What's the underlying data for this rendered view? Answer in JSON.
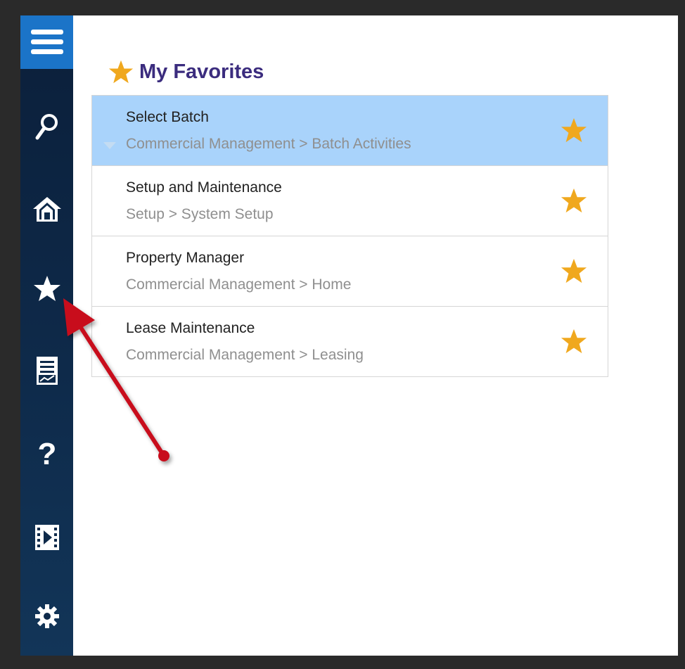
{
  "sidebar": {
    "items": [
      {
        "icon": "menu-icon"
      },
      {
        "icon": "search-icon"
      },
      {
        "icon": "home-icon"
      },
      {
        "icon": "star-icon"
      },
      {
        "icon": "report-icon"
      },
      {
        "icon": "help-icon"
      },
      {
        "icon": "video-icon"
      },
      {
        "icon": "gear-icon"
      }
    ]
  },
  "favorites": {
    "title": "My Favorites",
    "items": [
      {
        "title": "Select Batch",
        "path": "Commercial Management > Batch Activities"
      },
      {
        "title": "Setup and Maintenance",
        "path": "Setup > System Setup"
      },
      {
        "title": "Property Manager",
        "path": "Commercial Management > Home"
      },
      {
        "title": "Lease Maintenance",
        "path": "Commercial Management > Leasing"
      }
    ]
  },
  "colors": {
    "sidebar_bg": "#0e2a4a",
    "menu_bg": "#1b74c8",
    "title_color": "#3b2c7e",
    "star_color": "#f0a81e",
    "selected_row": "#a9d3fb",
    "annotation_arrow": "#c8101c"
  }
}
